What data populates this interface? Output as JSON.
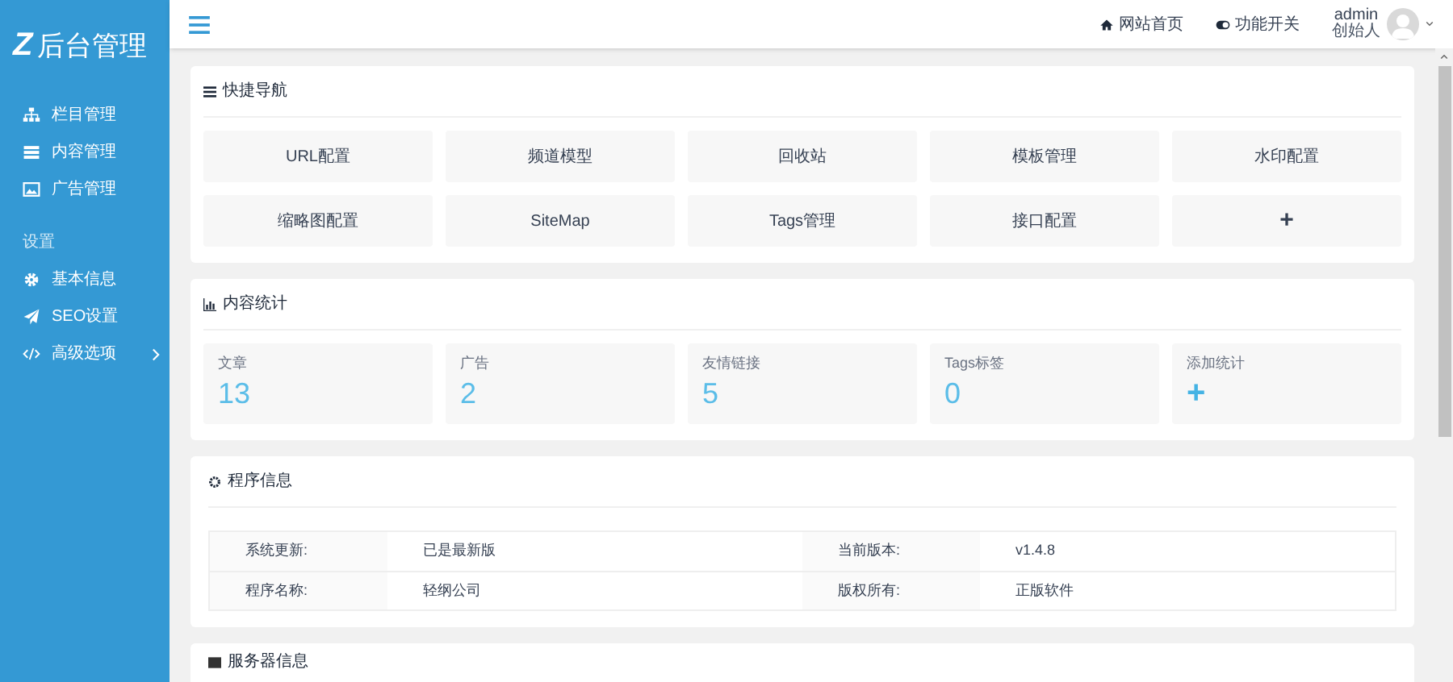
{
  "sidebar": {
    "logo_letter": "Z",
    "logo_text": "后台管理",
    "groups": [
      {
        "items": [
          {
            "label": "栏目管理",
            "kind": "sitemap"
          },
          {
            "label": "内容管理",
            "kind": "list"
          },
          {
            "label": "广告管理",
            "kind": "image"
          }
        ]
      },
      {
        "title": "设置",
        "items": [
          {
            "label": "基本信息",
            "kind": "gear"
          },
          {
            "label": "SEO设置",
            "kind": "plane"
          },
          {
            "label": "高级选项",
            "kind": "code",
            "expandable": true
          }
        ]
      }
    ]
  },
  "topbar": {
    "links": [
      {
        "label": "网站首页",
        "kind": "home"
      },
      {
        "label": "功能开关",
        "kind": "toggle"
      }
    ],
    "user": {
      "name": "admin",
      "role": "创始人"
    }
  },
  "quick_nav": {
    "title": "快捷导航",
    "items": [
      {
        "label": "URL配置"
      },
      {
        "label": "频道模型"
      },
      {
        "label": "回收站"
      },
      {
        "label": "模板管理"
      },
      {
        "label": "水印配置"
      },
      {
        "label": "缩略图配置"
      },
      {
        "label": "SiteMap"
      },
      {
        "label": "Tags管理"
      },
      {
        "label": "接口配置"
      },
      {
        "label": "+",
        "kind": "add"
      }
    ]
  },
  "stats": {
    "title": "内容统计",
    "items": [
      {
        "label": "文章",
        "value": "13"
      },
      {
        "label": "广告",
        "value": "2"
      },
      {
        "label": "友情链接",
        "value": "5"
      },
      {
        "label": "Tags标签",
        "value": "0"
      },
      {
        "label": "添加统计",
        "value": "+",
        "kind": "add"
      }
    ]
  },
  "program_info": {
    "title": "程序信息",
    "rows": [
      [
        "系统更新:",
        "已是最新版",
        "当前版本:",
        "v1.4.8"
      ],
      [
        "程序名称:",
        "轻纲公司",
        "版权所有:",
        "正版软件"
      ]
    ]
  },
  "next_section": {
    "title": "服务器信息"
  }
}
